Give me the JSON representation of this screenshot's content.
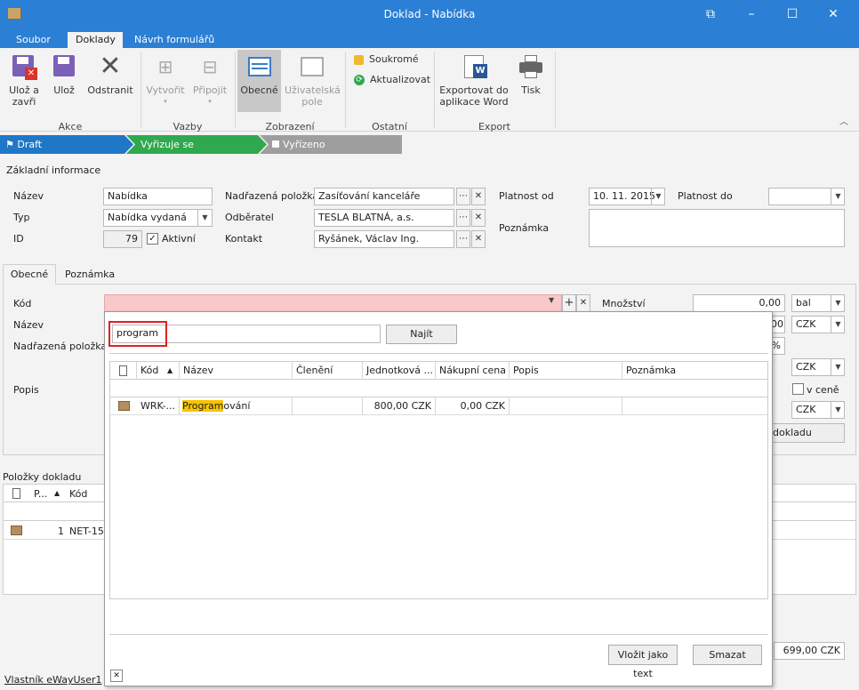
{
  "window": {
    "title": "Doklad - Nabídka"
  },
  "menu": {
    "tabs": [
      "Soubor",
      "Doklady",
      "Návrh formulářů"
    ]
  },
  "ribbon": {
    "save_close": [
      "Ulož a",
      "zavři"
    ],
    "save": "Ulož",
    "delete": "Odstranit",
    "create": "Vytvořit",
    "attach": "Připojit",
    "general": "Obecné",
    "user_fields": [
      "Uživatelská",
      "pole"
    ],
    "private": "Soukromé",
    "refresh": "Aktualizovat",
    "export_word": [
      "Exportovat do",
      "aplikace Word"
    ],
    "print": "Tisk",
    "groups": [
      "Akce",
      "Vazby",
      "Zobrazení",
      "Ostatní",
      "Export"
    ]
  },
  "workflow": {
    "steps": [
      "Draft",
      "Vyřizuje se",
      "Vyřízeno"
    ]
  },
  "basic": {
    "section": "Základní informace",
    "name_label": "Název",
    "name_value": "Nabídka",
    "type_label": "Typ",
    "type_value": "Nabídka vydaná",
    "id_label": "ID",
    "id_value": "79",
    "active_label": "Aktivní",
    "parent_label": "Nadřazená položka",
    "parent_value": "Zasíťování kanceláře",
    "customer_label": "Odběratel",
    "customer_value": "TESLA BLATNÁ, a.s.",
    "contact_label": "Kontakt",
    "contact_value": "Ryšánek, Václav Ing.",
    "valid_from_label": "Platnost od",
    "valid_from_value": "10. 11. 2015",
    "valid_to_label": "Platnost do",
    "note_label": "Poznámka"
  },
  "tabs": [
    "Obecné",
    "Poznámka"
  ],
  "item": {
    "code_label": "Kód",
    "name_label": "Název",
    "parent_label": "Nadřazená položka",
    "desc_label": "Popis",
    "qty_label": "Množství",
    "qty_value": "0,00",
    "unit": "bal",
    "cur1": "CZK",
    "cur2": "CZK",
    "cur3": "CZK",
    "percent": "%",
    "price_check": "v ceně",
    "value_00": "00",
    "doc_btn": "dokladu"
  },
  "items_section": {
    "title": "Položky dokladu",
    "col_p": "P...",
    "col_code": "Kód",
    "row_num": "1",
    "row_code": "NET-159"
  },
  "footer": {
    "owner": "Vlastník eWayUser1",
    "total": "699,00 CZK"
  },
  "popup": {
    "search_value": "program",
    "find_button": "Najít",
    "columns": [
      "Kód",
      "Název",
      "Členění",
      "Jednotková ...",
      "Nákupní cena",
      "Popis",
      "Poznámka"
    ],
    "row": {
      "code": "WRK-...",
      "name_highlight": "Program",
      "name_rest": "ování",
      "unit_price": "800,00 CZK",
      "purchase_price": "0,00 CZK"
    },
    "insert_text": "Vložit jako text",
    "clear": "Smazat"
  },
  "colors": {
    "accent": "#2b7fd4",
    "draft": "#1f77c8",
    "in_progress": "#2fa84f",
    "done": "#9e9e9e",
    "invalid": "#f9c8c8",
    "highlight": "#f7c400"
  }
}
